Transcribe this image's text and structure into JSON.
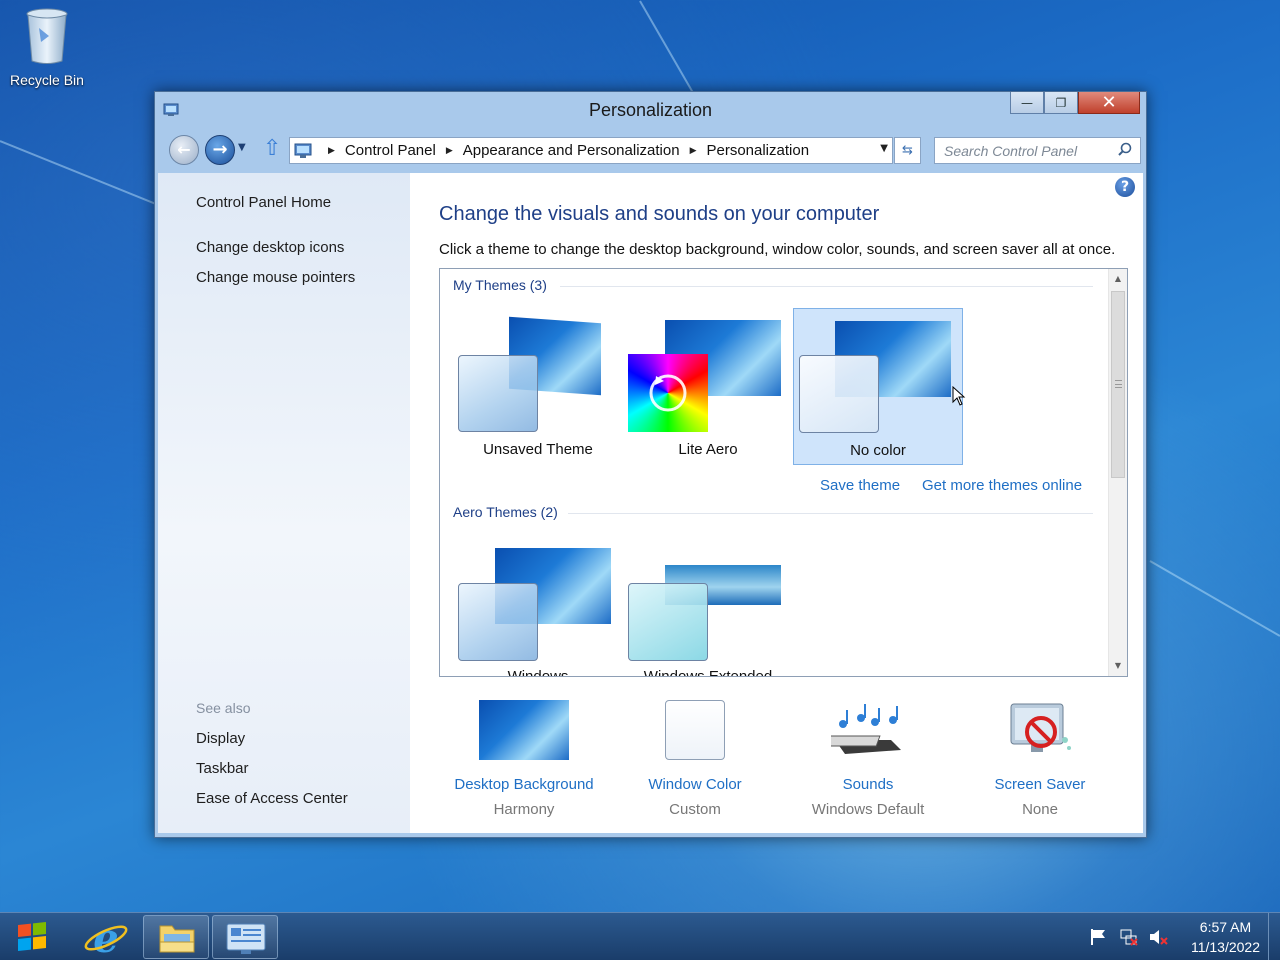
{
  "desktop": {
    "recycle_bin_label": "Recycle Bin"
  },
  "window": {
    "title": "Personalization",
    "minimize_glyph": "—",
    "maximize_glyph": "❐",
    "close_glyph": "✕",
    "breadcrumbs": [
      "Control Panel",
      "Appearance and Personalization",
      "Personalization"
    ],
    "search_placeholder": "Search Control Panel",
    "help_glyph": "?"
  },
  "sidebar": {
    "home": "Control Panel Home",
    "links": [
      "Change desktop icons",
      "Change mouse pointers"
    ],
    "see_also_header": "See also",
    "see_also": [
      "Display",
      "Taskbar",
      "Ease of Access Center"
    ]
  },
  "main": {
    "heading": "Change the visuals and sounds on your computer",
    "description": "Click a theme to change the desktop background, window color, sounds, and screen saver all at once.",
    "my_themes_header": "My Themes (3)",
    "my_themes": [
      "Unsaved Theme",
      "Lite Aero",
      "No color"
    ],
    "selected_theme": "No color",
    "save_theme_link": "Save theme",
    "get_more_link": "Get more themes online",
    "aero_themes_header": "Aero Themes (2)",
    "aero_themes": [
      "Windows",
      "Windows Extended"
    ]
  },
  "bottom": [
    {
      "label": "Desktop Background",
      "value": "Harmony",
      "icon": "wallpaper-icon"
    },
    {
      "label": "Window Color",
      "value": "Custom",
      "icon": "window-color-icon"
    },
    {
      "label": "Sounds",
      "value": "Windows Default",
      "icon": "sounds-icon"
    },
    {
      "label": "Screen Saver",
      "value": "None",
      "icon": "screen-saver-icon"
    }
  ],
  "taskbar": {
    "time": "6:57 AM",
    "date": "11/13/2022"
  },
  "colors": {
    "accent_link": "#1f6fc5",
    "heading": "#1e3f87",
    "selection": "#cfe4fb"
  }
}
